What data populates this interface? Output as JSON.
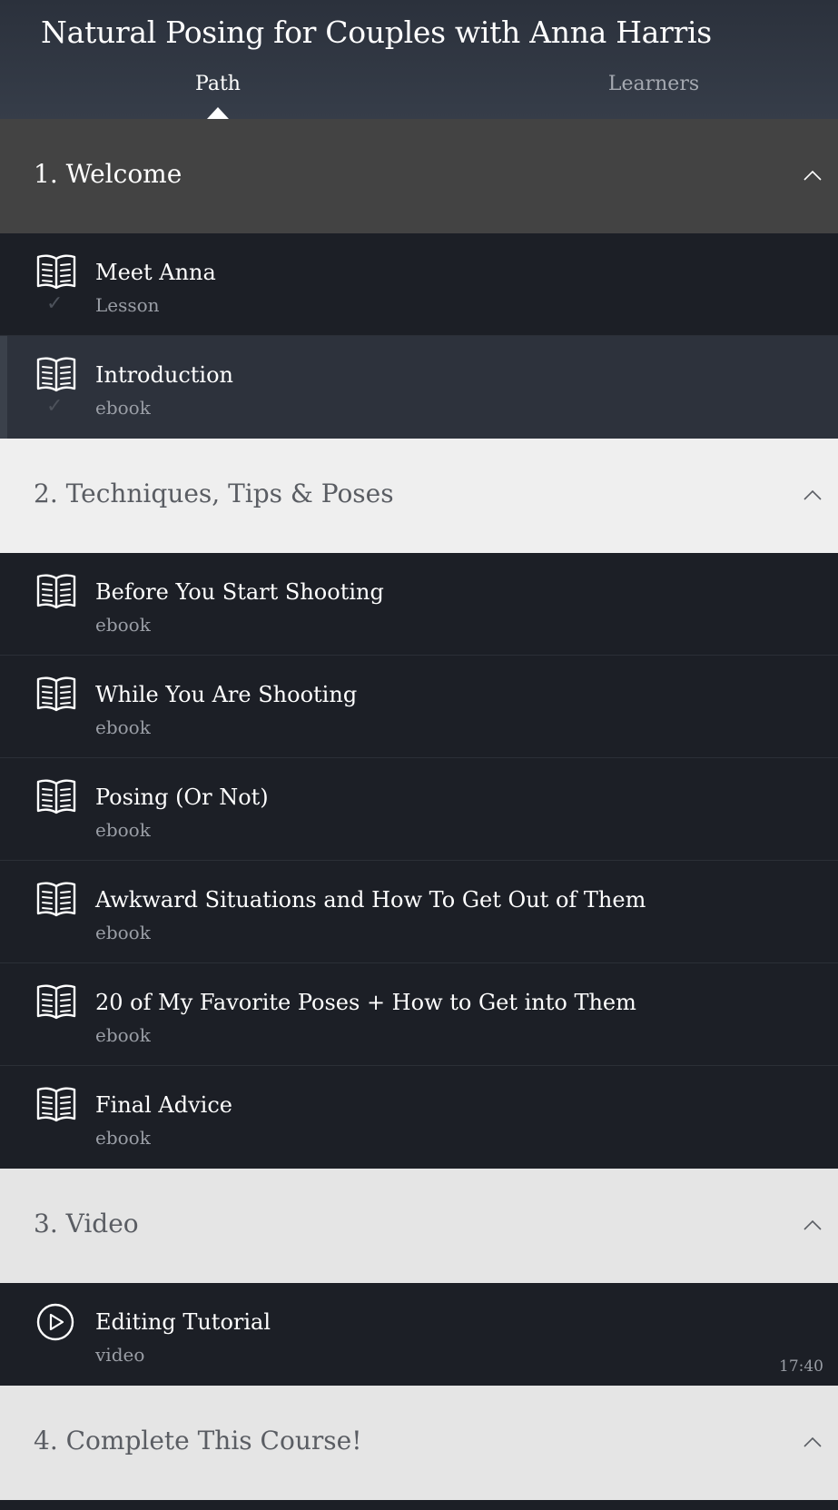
{
  "header": {
    "course_title": "Natural Posing for Couples with Anna Harris",
    "tabs": [
      {
        "label": "Path",
        "active": true
      },
      {
        "label": "Learners",
        "active": false
      }
    ]
  },
  "sections": [
    {
      "title": "1. Welcome",
      "items": [
        {
          "title": "Meet Anna",
          "type": "Lesson",
          "icon": "book-icon",
          "completed": true
        },
        {
          "title": "Introduction",
          "type": "ebook",
          "icon": "book-icon",
          "completed": true
        }
      ]
    },
    {
      "title": "2. Techniques, Tips & Poses",
      "items": [
        {
          "title": "Before You Start Shooting",
          "type": "ebook",
          "icon": "book-icon"
        },
        {
          "title": "While You Are Shooting",
          "type": "ebook",
          "icon": "book-icon"
        },
        {
          "title": "Posing (Or Not)",
          "type": "ebook",
          "icon": "book-icon"
        },
        {
          "title": "Awkward Situations and How To Get Out of Them",
          "type": "ebook",
          "icon": "book-icon"
        },
        {
          "title": "20 of My Favorite Poses + How to Get into Them",
          "type": "ebook",
          "icon": "book-icon"
        },
        {
          "title": "Final Advice",
          "type": "ebook",
          "icon": "book-icon"
        }
      ]
    },
    {
      "title": "3. Video",
      "items": [
        {
          "title": "Editing Tutorial",
          "type": "video",
          "icon": "play-circle-icon",
          "duration": "17:40"
        }
      ]
    },
    {
      "title": "4. Complete This Course!",
      "items": []
    }
  ],
  "check_glyph": "✓",
  "colors": {
    "header_bg": "#363d49",
    "active_section_bg": "#434343",
    "item_bg": "#1c1f26",
    "active_item_bg": "#2d323c",
    "light_section_bg": "#efefef"
  }
}
